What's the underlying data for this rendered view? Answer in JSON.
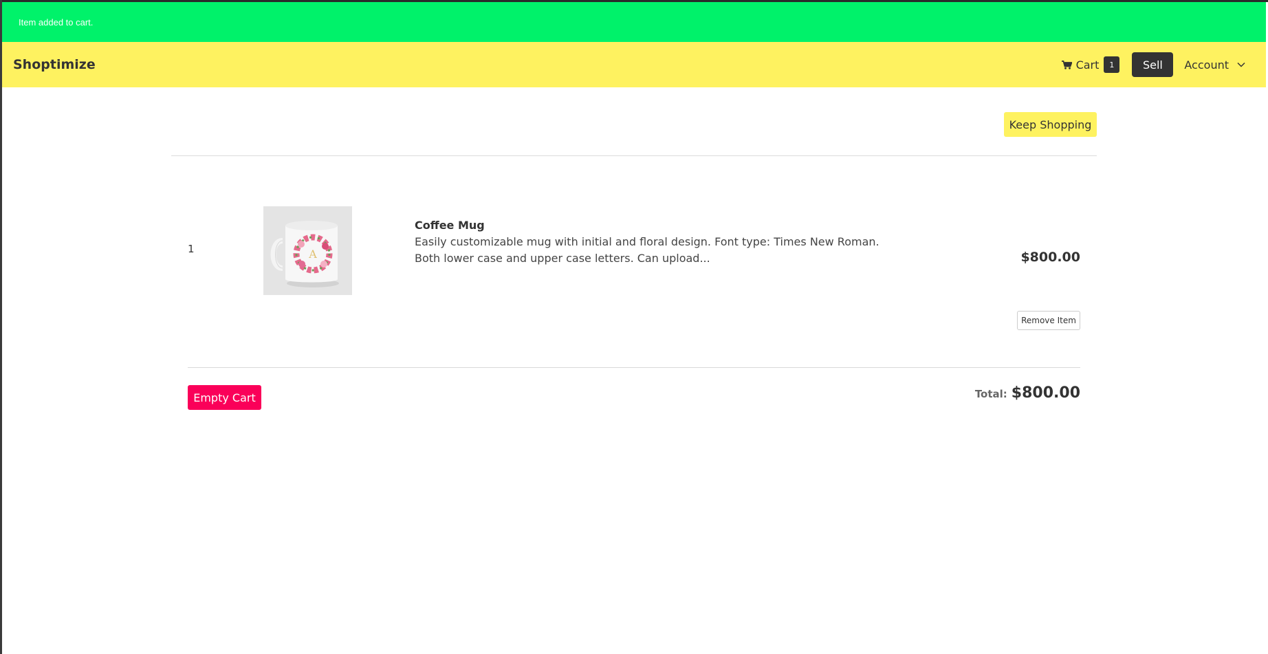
{
  "notification": {
    "message": "Item added to cart."
  },
  "navbar": {
    "brand": "Shoptimize",
    "cart_label": "Cart",
    "cart_count": "1",
    "sell_label": "Sell",
    "account_label": "Account",
    "icons": {
      "cart": "shopping-cart-icon",
      "account_dropdown": "chevron-down-icon"
    }
  },
  "toolbar": {
    "keep_shopping_label": "Keep Shopping"
  },
  "cart": {
    "items": [
      {
        "quantity": "1",
        "name": "Coffee Mug",
        "description": "Easily customizable mug with initial and floral design. Font type: Times New Roman. Both lower case and upper case letters. Can upload...",
        "price": "$800.00",
        "remove_label": "Remove Item"
      }
    ],
    "empty_cart_label": "Empty Cart",
    "total_label": "Total:",
    "total_value": "$800.00"
  },
  "colors": {
    "notification_bg": "#00f26a",
    "navbar_bg": "#fef260",
    "dark": "#333333",
    "danger": "#fa0059"
  }
}
